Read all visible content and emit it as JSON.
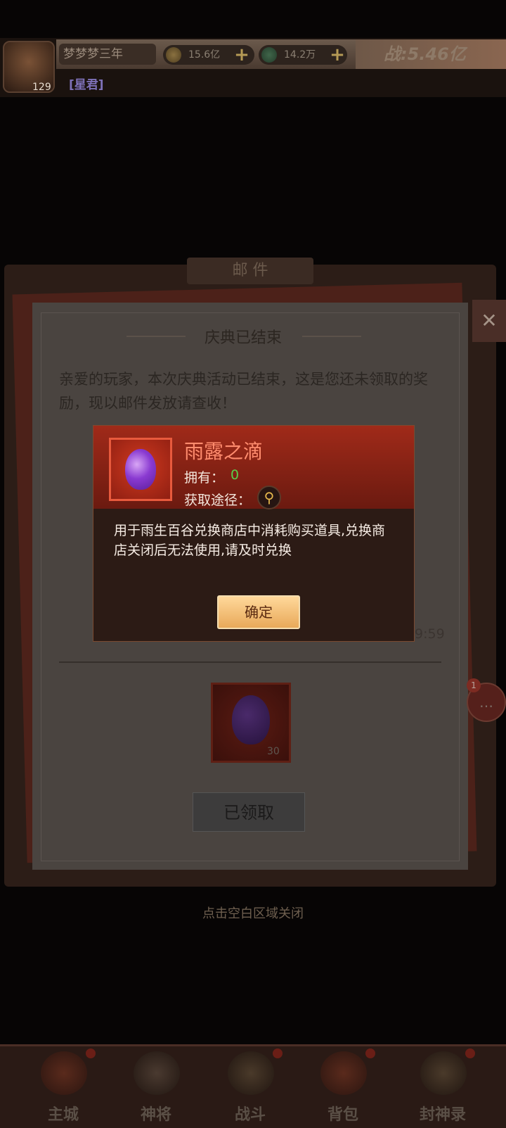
{
  "player": {
    "name": "梦梦梦三年",
    "level": "129",
    "title": "[星君]"
  },
  "resources": {
    "gold": "15.6亿",
    "jade": "14.2万",
    "plus": "+"
  },
  "power": "战:5.46亿",
  "mail": {
    "window_title": "邮 件",
    "close_glyph": "✕",
    "subject": "庆典已结束",
    "body": "亲爱的玩家，本次庆典活动已结束，这是您还未领取的奖励，现以邮件发放请查收！",
    "date_fragment": "9:59",
    "reward_count": "30",
    "claim_button": "已领取",
    "chat_badge": "1",
    "chat_icon": "chat-bubble-icon"
  },
  "item_popup": {
    "name": "雨露之滴",
    "own_label": "拥有：",
    "own_value": "0",
    "source_label": "获取途径：",
    "search_icon": "magnifier-icon",
    "description": "用于雨生百谷兑换商店中消耗购买道具,兑换商店关闭后无法使用,请及时兑换",
    "confirm": "确定"
  },
  "close_hint": "点击空白区域关闭",
  "nav": [
    {
      "label": "主城",
      "icon": "city-icon"
    },
    {
      "label": "神将",
      "icon": "hero-icon"
    },
    {
      "label": "战斗",
      "icon": "swords-icon"
    },
    {
      "label": "背包",
      "icon": "bag-icon"
    },
    {
      "label": "封神录",
      "icon": "record-icon"
    }
  ],
  "colors": {
    "accent_red": "#a02a19",
    "item_name": "#ff8c6e",
    "own_value": "#5ad04b",
    "confirm_button": "#f4c07a"
  }
}
